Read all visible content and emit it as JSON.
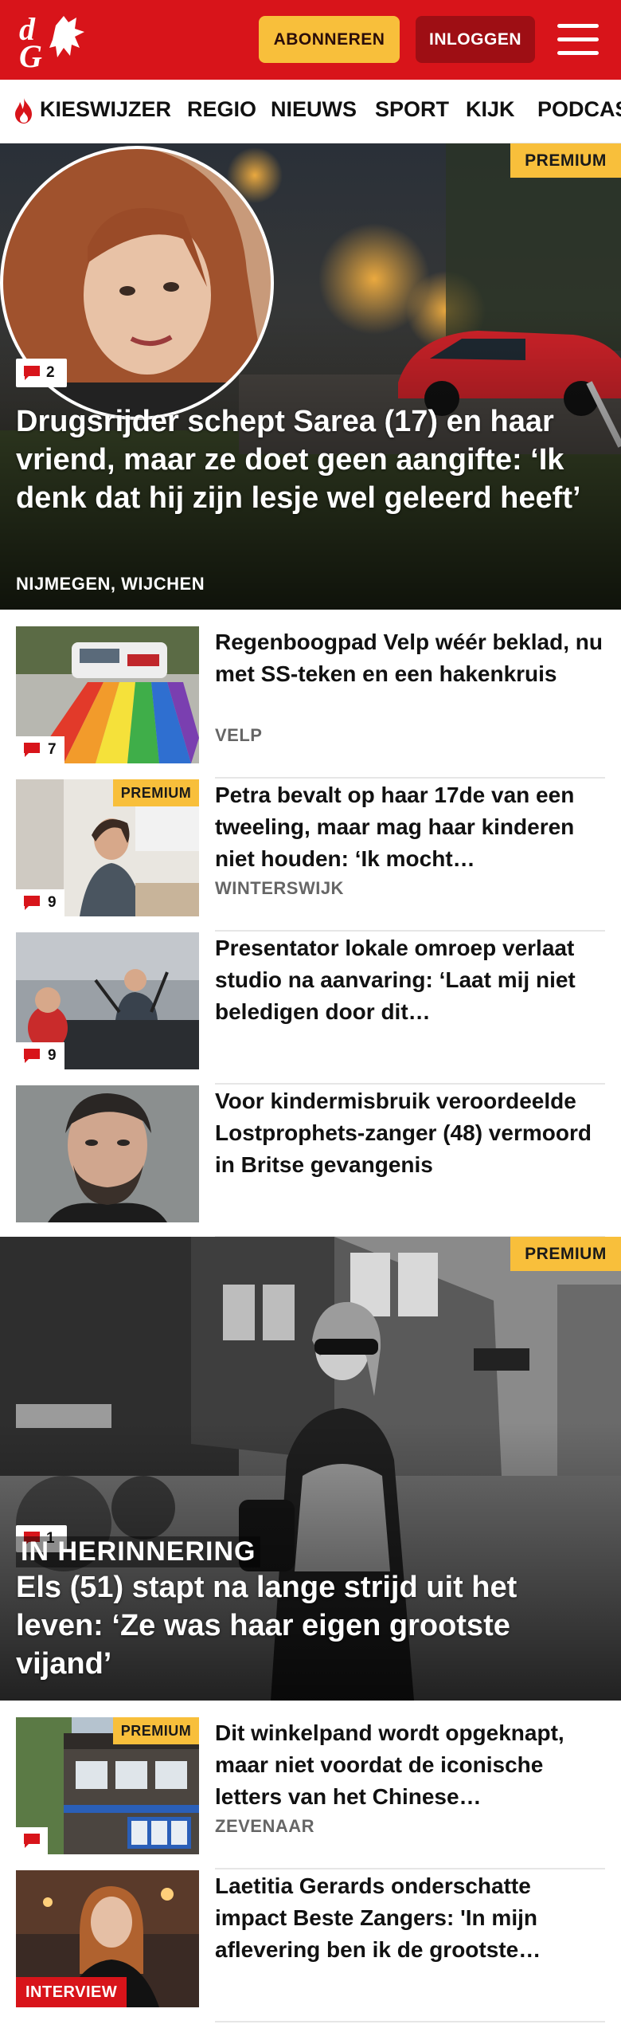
{
  "header": {
    "logo_text": "dG",
    "subscribe_label": "ABONNEREN",
    "login_label": "INLOGGEN",
    "menu_icon": "hamburger-menu-icon",
    "brand_color": "#d8141a",
    "subscribe_color": "#f8bf3b",
    "login_color": "#9e0e14"
  },
  "nav": {
    "items": [
      {
        "label": "KIESWIJZER",
        "icon": "flame-icon"
      },
      {
        "label": "REGIO"
      },
      {
        "label": "NIEUWS"
      },
      {
        "label": "SPORT"
      },
      {
        "label": "KIJK"
      },
      {
        "label": "PODCAS"
      }
    ]
  },
  "hero": {
    "premium_label": "PREMIUM",
    "comments": "2",
    "title": "Drugsrijder schept Sarea (17) en haar vriend, maar ze doet geen aangifte: ‘Ik denk dat hij zijn lesje wel geleerd heeft’",
    "location": "NIJMEGEN, WIJCHEN"
  },
  "articles_top": [
    {
      "title": "Regenboogpad Velp wéér beklad, nu met SS-teken en een hakenkruis",
      "location": "VELP",
      "comments": "7",
      "premium": false
    },
    {
      "title": "Petra bevalt op haar 17de van een tweeling, maar mag haar kinderen niet houden: ‘Ik mocht…",
      "location": "WINTERSWIJK",
      "comments": "9",
      "premium": true,
      "premium_label": "PREMIUM"
    },
    {
      "title": "Presentator lokale omroep verlaat studio na aanvaring: ‘Laat mij niet beledigen door dit…",
      "location": "",
      "comments": "9",
      "premium": false
    },
    {
      "title": "Voor kindermisbruik veroordeelde Lostprophets-zanger (48) vermoord in Britse gevangenis",
      "location": "",
      "comments": "",
      "premium": false
    }
  ],
  "hero2": {
    "premium_label": "PREMIUM",
    "comments": "1",
    "kicker": "IN HERINNERING",
    "title": "Els (51) stapt na lange strijd uit het leven: ‘Ze was haar eigen grootste vijand’"
  },
  "articles_bottom": [
    {
      "title": "Dit winkelpand wordt opgeknapt, maar niet voordat de iconische letters van het Chinese…",
      "location": "ZEVENAAR",
      "comments": "",
      "premium": true,
      "premium_label": "PREMIUM"
    },
    {
      "title": "Laetitia Gerards onderschatte impact Beste Zangers: 'In mijn aflevering ben ik de grootste…",
      "location": "",
      "tag": "INTERVIEW"
    }
  ]
}
